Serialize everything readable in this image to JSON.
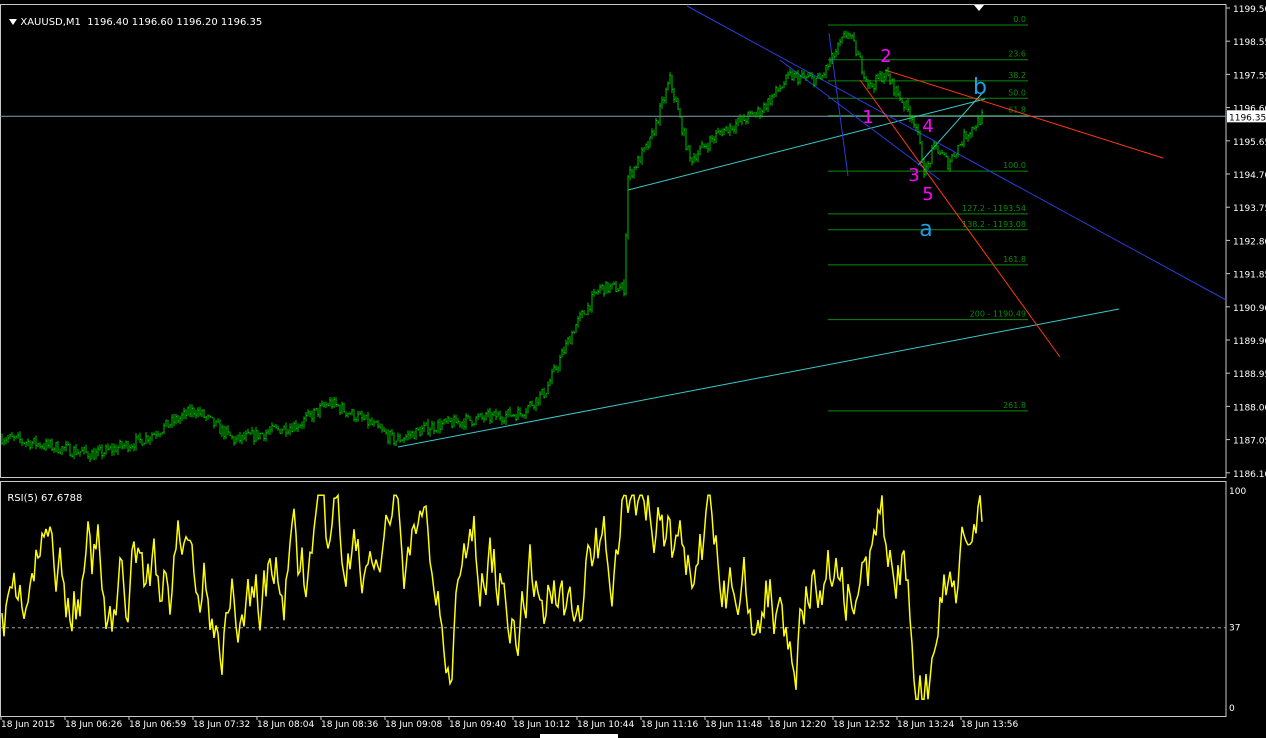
{
  "main_window": {
    "symbol_label": "XAUUSD,M1",
    "ohlc": "1196.40 1196.60 1196.20 1196.35",
    "current_price_label": "1196.35"
  },
  "price_axis": {
    "ticks": [
      "1199.50",
      "1198.55",
      "1197.55",
      "1196.60",
      "1195.65",
      "1194.70",
      "1193.75",
      "1192.80",
      "1191.85",
      "1190.90",
      "1189.90",
      "1188.95",
      "1188.00",
      "1187.05",
      "1186.10"
    ]
  },
  "time_axis": {
    "ticks": [
      "18 Jun 2015",
      "18 Jun 06:26",
      "18 Jun 06:59",
      "18 Jun 07:32",
      "18 Jun 08:04",
      "18 Jun 08:36",
      "18 Jun 09:08",
      "18 Jun 09:40",
      "18 Jun 10:12",
      "18 Jun 10:44",
      "18 Jun 11:16",
      "18 Jun 11:48",
      "18 Jun 12:20",
      "18 Jun 12:52",
      "18 Jun 13:24",
      "18 Jun 13:56"
    ]
  },
  "fibonacci": {
    "levels": [
      {
        "label": "0.0",
        "price": 1198.98
      },
      {
        "label": "23.6",
        "price": 1197.98
      },
      {
        "label": "38.2",
        "price": 1197.37
      },
      {
        "label": "50.0",
        "price": 1196.87
      },
      {
        "label": "61.8",
        "price": 1196.37
      },
      {
        "label": "100.0",
        "price": 1194.77
      },
      {
        "label": "127.2 - 1193.54",
        "price": 1193.54
      },
      {
        "label": "138.2 - 1193.08",
        "price": 1193.08
      },
      {
        "label": "161.8",
        "price": 1192.07
      },
      {
        "label": "200 - 1190.49",
        "price": 1190.49
      },
      {
        "label": "261.8",
        "price": 1187.86
      }
    ]
  },
  "wave_labels": [
    {
      "text": "1",
      "color": "#ff00ff"
    },
    {
      "text": "2",
      "color": "#ff00ff"
    },
    {
      "text": "3",
      "color": "#ff00ff"
    },
    {
      "text": "4",
      "color": "#ff00ff"
    },
    {
      "text": "5",
      "color": "#ff00ff"
    },
    {
      "text": "a",
      "color": "#1e9fe6"
    },
    {
      "text": "b",
      "color": "#1e9fe6"
    }
  ],
  "rsi_window": {
    "label": "RSI(5) 67.6788",
    "scale_ticks": [
      "100",
      "37",
      "0"
    ],
    "level": 37
  },
  "chart_data": [
    {
      "type": "line",
      "title": "XAUUSD,M1",
      "series": [
        {
          "name": "XAUUSD,M1",
          "x": [
            "18 Jun 2015",
            "18 Jun 06:26",
            "18 Jun 06:59",
            "18 Jun 07:32",
            "18 Jun 08:04",
            "18 Jun 08:36",
            "18 Jun 09:08",
            "18 Jun 09:40",
            "18 Jun 10:12",
            "18 Jun 10:44",
            "18 Jun 11:16",
            "18 Jun 11:48",
            "18 Jun 12:20",
            "18 Jun 12:52",
            "18 Jun 13:24",
            "18 Jun 13:56"
          ],
          "close": [
            1187.1,
            1186.9,
            1187.0,
            1187.6,
            1187.0,
            1187.2,
            1187.8,
            1187.5,
            1187.6,
            1188.0,
            1189.2,
            1191.0,
            1196.7,
            1195.6,
            1196.7,
            1198.4,
            1197.6,
            1194.9,
            1196.4
          ]
        }
      ],
      "ylim": [
        1186.1,
        1199.5
      ]
    },
    {
      "type": "line",
      "title": "RSI(5) 67.6788",
      "series": [
        {
          "name": "RSI(5)",
          "level": 37
        }
      ],
      "ylim": [
        0,
        100
      ]
    }
  ],
  "colors": {
    "candles": "#00c000",
    "rsi": "#ffff00",
    "fib": "#0b8a0b",
    "trend_cyan": "#3cc8c8",
    "trend_blue": "#2a3cd8",
    "trend_red": "#ff3a10"
  }
}
